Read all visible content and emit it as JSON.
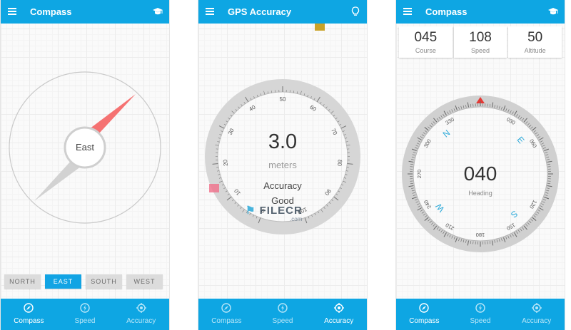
{
  "screen1": {
    "title": "Compass",
    "center_label": "East",
    "directions": [
      "NORTH",
      "EAST",
      "SOUTH",
      "WEST"
    ],
    "active_direction": "EAST"
  },
  "screen2": {
    "title": "GPS Accuracy",
    "value": "3.0",
    "unit": "meters",
    "label": "Accuracy",
    "quality": "Good",
    "scale_labels": [
      "0",
      "10",
      "20",
      "30",
      "40",
      "50",
      "60",
      "70",
      "80",
      "90",
      "100"
    ],
    "watermark": "FILECR",
    "watermark_domain": ".com"
  },
  "screen3": {
    "title": "Compass",
    "stats": [
      {
        "value": "045",
        "label": "Course"
      },
      {
        "value": "108",
        "label": "Speed"
      },
      {
        "value": "50",
        "label": "Altitude"
      }
    ],
    "heading_value": "040",
    "heading_label": "Heading",
    "cardinals": [
      "N",
      "E",
      "S",
      "W"
    ],
    "degree_labels": [
      "030",
      "060",
      "120",
      "150",
      "180",
      "210",
      "240",
      "270",
      "300",
      "330"
    ]
  },
  "nav": [
    "Compass",
    "Speed",
    "Accuracy"
  ],
  "colors": {
    "primary": "#0ea6e3",
    "needle_red": "#f57272",
    "marker_red": "#e53935",
    "gold_marker": "#c9a227",
    "cardinal_blue": "#2aa8d8"
  },
  "icons": {
    "menu": "menu-icon",
    "mortarboard": "mortarboard-icon",
    "lightbulb": "lightbulb-icon",
    "compass": "compass-icon",
    "speed": "speedometer-icon",
    "accuracy": "crosshair-icon"
  }
}
